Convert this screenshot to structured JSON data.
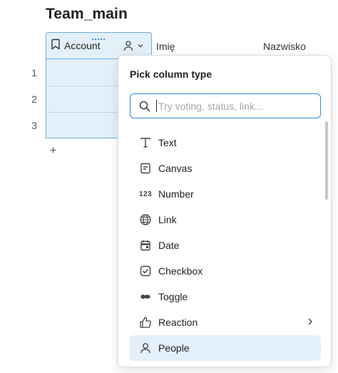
{
  "page": {
    "title": "Team_main"
  },
  "table": {
    "selected_column": {
      "label": "Account",
      "type_icon": "people-icon"
    },
    "columns": [
      "Imię",
      "Nazwisko"
    ],
    "rows": [
      "1",
      "2",
      "3"
    ],
    "add_row_label": "+"
  },
  "popup": {
    "title": "Pick column type",
    "search_placeholder": "Try voting, status, link...",
    "items": [
      {
        "label": "Text",
        "icon": "text-icon"
      },
      {
        "label": "Canvas",
        "icon": "canvas-icon"
      },
      {
        "label": "Number",
        "icon": "number-icon"
      },
      {
        "label": "Link",
        "icon": "globe-icon"
      },
      {
        "label": "Date",
        "icon": "calendar-icon"
      },
      {
        "label": "Checkbox",
        "icon": "checkbox-icon"
      },
      {
        "label": "Toggle",
        "icon": "toggle-icon"
      },
      {
        "label": "Reaction",
        "icon": "thumbs-up-icon",
        "has_submenu": true
      },
      {
        "label": "People",
        "icon": "person-icon",
        "selected": true
      }
    ],
    "number_icon_text": "123"
  },
  "colors": {
    "accent": "#2f89d4",
    "selection_bg": "#e3f0f9"
  }
}
